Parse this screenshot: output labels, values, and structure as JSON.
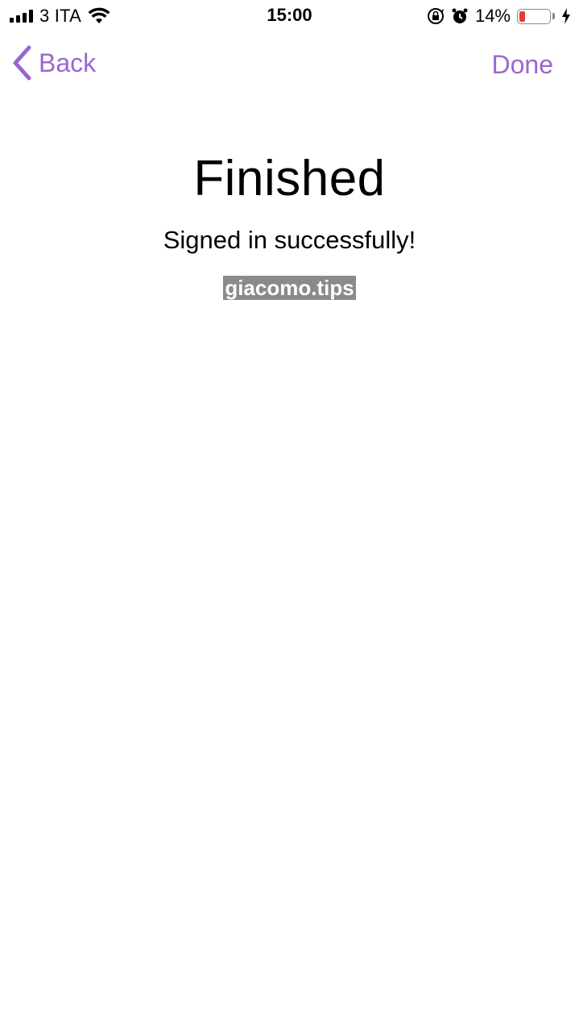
{
  "status_bar": {
    "carrier": "3 ITA",
    "time": "15:00",
    "battery_percent": "14%",
    "battery_level": 0.14,
    "icons": [
      "signal-icon",
      "wifi-icon",
      "rotation-lock-icon",
      "alarm-icon",
      "battery-icon",
      "charging-icon"
    ]
  },
  "nav": {
    "back_label": "Back",
    "done_label": "Done",
    "accent_color": "#9b66cf"
  },
  "content": {
    "title": "Finished",
    "subtitle": "Signed in successfully!",
    "watermark": "giacomo.tips"
  }
}
